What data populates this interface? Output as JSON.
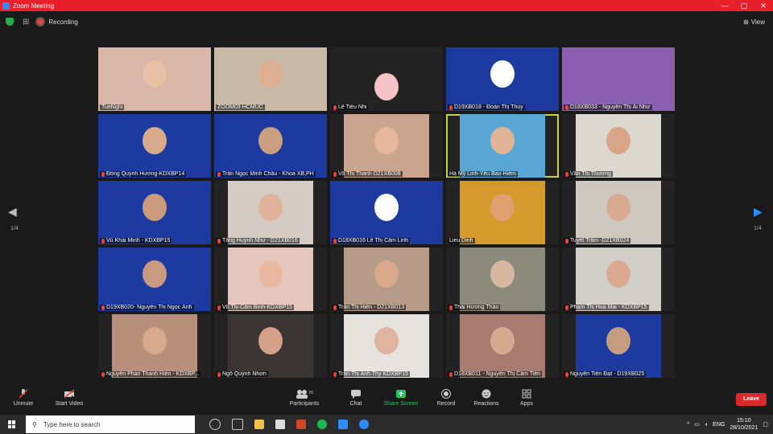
{
  "window": {
    "title": "Zoom Meeting"
  },
  "topbar": {
    "recording_label": "Recording",
    "view_label": "View"
  },
  "pagination": {
    "left": "1/4",
    "right": "1/4"
  },
  "participants": [
    {
      "name": "TueNghi",
      "bg": "#d8b7a8",
      "face": "#e8c0a6",
      "mic": false
    },
    {
      "name": "ZOOM03 HCMUC",
      "bg": "#c9b9a7",
      "face": "#dcb090",
      "mic": false
    },
    {
      "name": "Lê Tiểu Nhi",
      "bg": "#232323",
      "face": "#f5c3c8",
      "mic": true
    },
    {
      "name": "D19XB018 - Đoàn Thị Thủy",
      "bg": "#1c3aa0",
      "face": "#ffffff",
      "mic": true
    },
    {
      "name": "D18XB033 - Nguyễn Thị Ái Như",
      "bg": "#8a5fb0",
      "face": "#8a5fb0",
      "mic": true
    },
    {
      "name": "Đồng Quỳnh Hương-KDXBP14",
      "bg": "#1c3aa0",
      "face": "#d9a98b",
      "mic": true
    },
    {
      "name": "Trần Ngọc Minh Châu - Khoa XB,PH",
      "bg": "#1c3aa0",
      "face": "#caa080",
      "mic": true
    },
    {
      "name": "Võ Thị Thanh D21XB008",
      "bg": "#c9a48e",
      "face": "#e6b79c",
      "mic": true
    },
    {
      "name": "Hà Mỹ Linh-Yêu Bảo Hiểm",
      "bg": "#5aa7d6",
      "face": "#e2b496",
      "mic": false
    },
    {
      "name": "Văn Thị Thương",
      "bg": "#dcd7cf",
      "face": "#d8a587",
      "mic": true
    },
    {
      "name": "Vũ Khải Minh - KDXBP15",
      "bg": "#1c3aa0",
      "face": "#c99a7b",
      "mic": true
    },
    {
      "name": "Tăng Huỳnh Như - D21XB016",
      "bg": "#d3cbc4",
      "face": "#e0b29a",
      "mic": true
    },
    {
      "name": "D18XB016 Lê Thị Cẩm Linh",
      "bg": "#1c3aa0",
      "face": "#ffffff",
      "mic": true
    },
    {
      "name": "Lieu Dinh",
      "bg": "#d59a2c",
      "face": "#e0a070",
      "mic": false
    },
    {
      "name": "Tuyết Trâm -D21XB024",
      "bg": "#cfc8c0",
      "face": "#d8ab90",
      "mic": true
    },
    {
      "name": "D19XB020- Nguyễn Thị Ngọc Ánh",
      "bg": "#1c3aa0",
      "face": "#c99a80",
      "mic": true
    },
    {
      "name": "Võ Thị Cẩm Bình-KDXBP15",
      "bg": "#e4c6bd",
      "face": "#e8b8a0",
      "mic": true
    },
    {
      "name": "Trần Thị Hiền - D21XB013",
      "bg": "#b59b88",
      "face": "#d9a98c",
      "mic": true
    },
    {
      "name": "Thái Hương Thảo",
      "bg": "#8c8a7a",
      "face": "#d6b8a0",
      "mic": true
    },
    {
      "name": "Phạm Thị Hoa Mai - KDXBP15",
      "bg": "#d2cfc8",
      "face": "#d9a990",
      "mic": true
    },
    {
      "name": "Nguyễn Phan Thanh Hiền - KDXBP...",
      "bg": "#b88f7a",
      "face": "#d9a98b",
      "mic": true
    },
    {
      "name": "Ngô Quỳnh Nhơn",
      "bg": "#3a3433",
      "face": "#d4a08a",
      "mic": true
    },
    {
      "name": "Trần Thị Ánh Thy KDXBP15",
      "bg": "#e6e2de",
      "face": "#e0b5a0",
      "mic": true
    },
    {
      "name": "D18XB011 - Nguyễn Thị Cẩm Tiên",
      "bg": "#a87a70",
      "face": "#d5a890",
      "mic": true
    },
    {
      "name": "Nguyễn Tiến Đạt - D19XB025",
      "bg": "#1c3aa0",
      "face": "#c69c80",
      "mic": true
    }
  ],
  "toolbar": {
    "unmute": "Unmute",
    "start_video": "Start Video",
    "participants": "Participants",
    "participants_count": "81",
    "chat": "Chat",
    "share_screen": "Share Screen",
    "record": "Record",
    "reactions": "Reactions",
    "apps": "Apps",
    "leave": "Leave"
  },
  "taskbar": {
    "search_placeholder": "Type here to search",
    "lang": "ENG",
    "time": "15:10",
    "date": "28/10/2021"
  },
  "colors": {
    "accent_red": "#e8202b",
    "share_green": "#22c55e",
    "active_speaker": "#c6d43c"
  }
}
